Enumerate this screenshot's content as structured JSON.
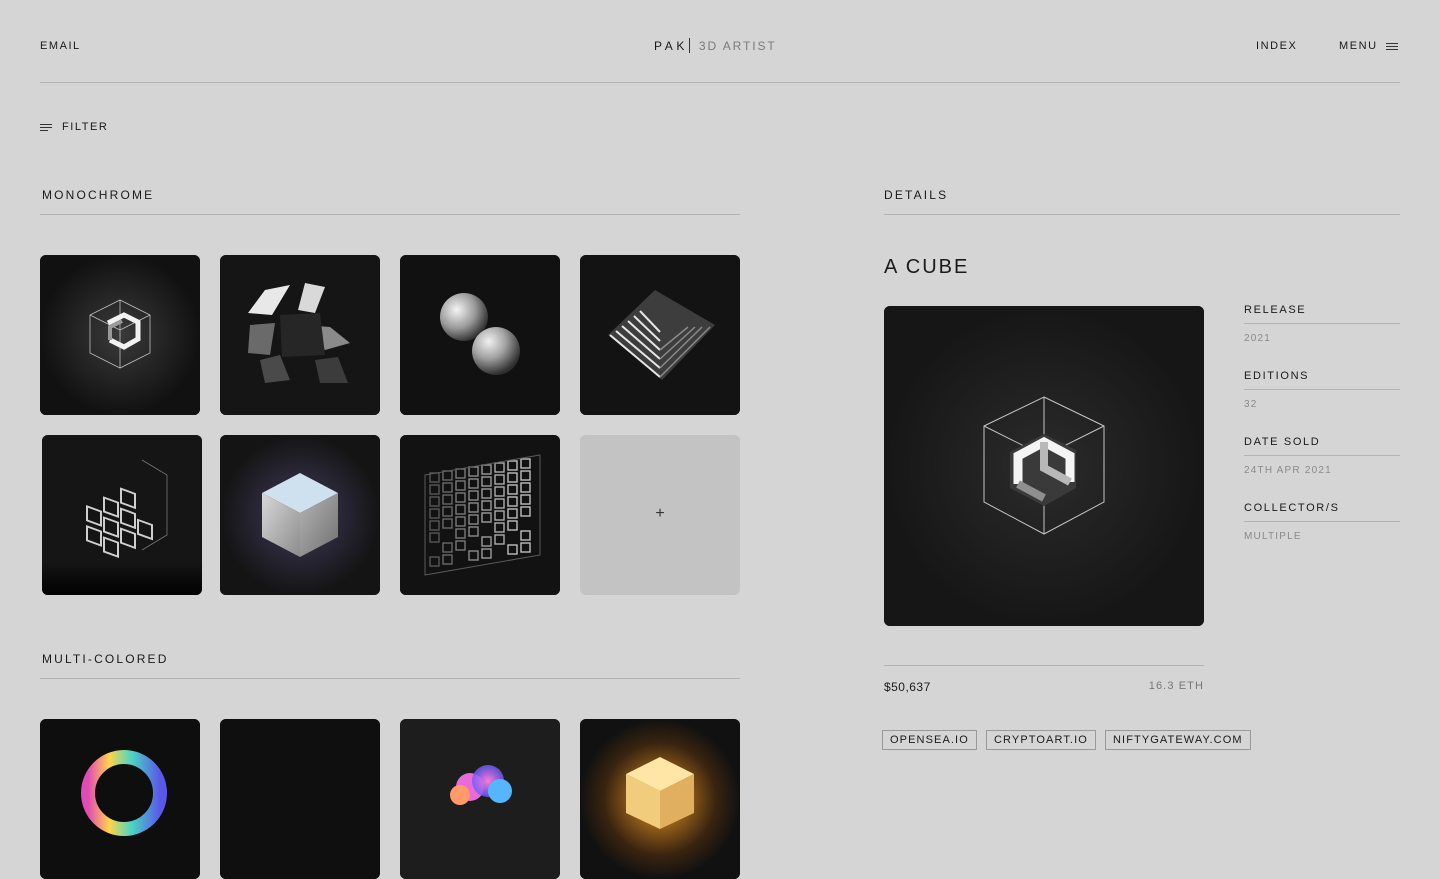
{
  "header": {
    "email_label": "EMAIL",
    "brand": "PAK",
    "brand_sub": "3D ARTIST",
    "index_label": "INDEX",
    "menu_label": "MENU"
  },
  "filter": {
    "label": "FILTER"
  },
  "sections": {
    "monochrome": {
      "title": "MONOCHROME",
      "tiles": [
        "wireframe-cube-art",
        "fractured-cube-art",
        "twin-spheres-art",
        "stepped-pyramid-art",
        "lattice-cube-art",
        "stone-cube-art",
        "voxel-grid-art"
      ],
      "add_label": "+"
    },
    "multicolored": {
      "title": "MULTI-COLORED",
      "tiles": [
        "iridescent-ring-art",
        "dark-art",
        "colored-cloud-art",
        "glowing-cube-art"
      ]
    }
  },
  "details": {
    "section_title": "DETAILS",
    "title": "A CUBE",
    "fields": [
      {
        "label": "RELEASE",
        "value": "2021"
      },
      {
        "label": "EDITIONS",
        "value": "32"
      },
      {
        "label": "DATE SOLD",
        "value": "24TH APR 2021"
      },
      {
        "label": "COLLECTOR/S",
        "value": "MULTIPLE"
      }
    ],
    "price_usd": "$50,637",
    "price_eth": "16.3 ETH",
    "marketplaces": [
      "OPENSEA.IO",
      "CRYPTOART.IO",
      "NIFTYGATEWAY.COM"
    ]
  }
}
